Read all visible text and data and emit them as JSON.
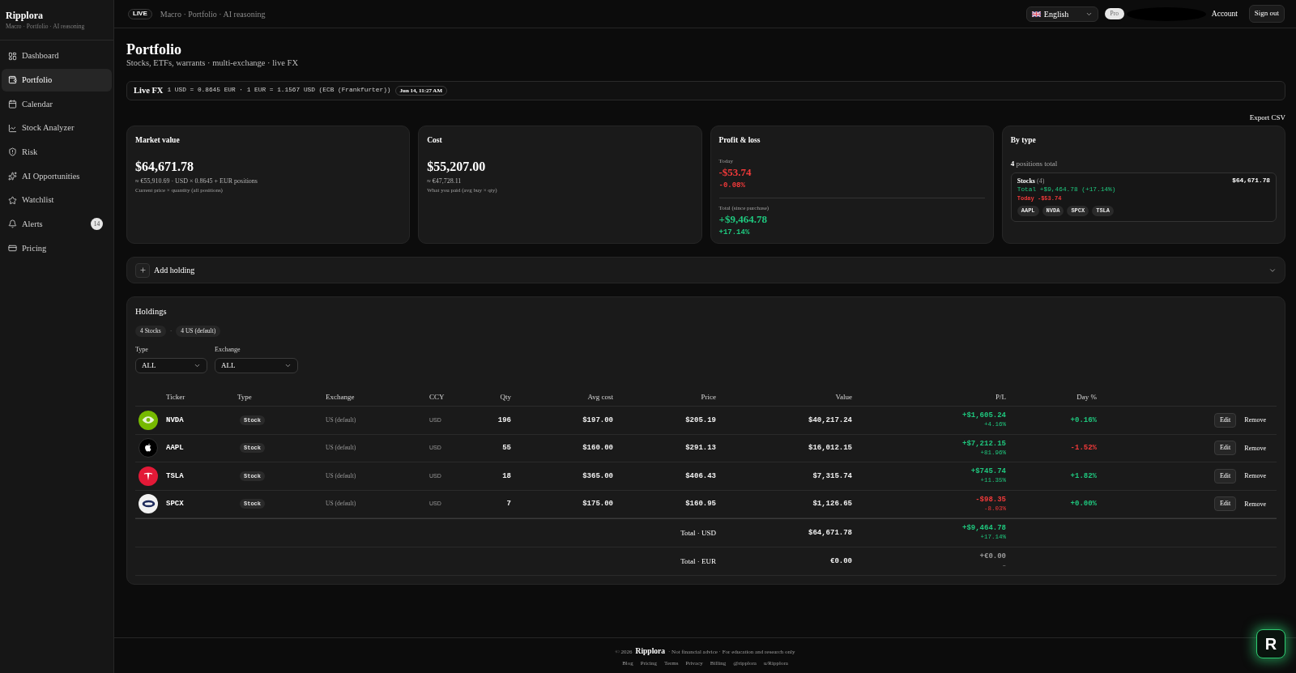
{
  "sidebar": {
    "brand": "Ripplora",
    "tagline": "Macro · Portfolio · AI reasoning",
    "items": [
      {
        "label": "Dashboard",
        "selected": false
      },
      {
        "label": "Portfolio",
        "selected": true
      },
      {
        "label": "Calendar",
        "selected": false
      },
      {
        "label": "Stock Analyzer",
        "selected": false
      },
      {
        "label": "Risk",
        "selected": false
      },
      {
        "label": "AI Opportunities",
        "selected": false
      },
      {
        "label": "Watchlist",
        "selected": false
      },
      {
        "label": "Alerts",
        "selected": false,
        "badge": "14"
      },
      {
        "label": "Pricing",
        "selected": false
      }
    ]
  },
  "top_bar": {
    "live_badge": "LIVE",
    "breadcrumb": "Macro · Portfolio · AI reasoning",
    "language": "English",
    "plan_badge": "Pro",
    "account_link": "Account",
    "sign_out": "Sign out"
  },
  "page": {
    "title": "Portfolio",
    "subtitle": "Stocks, ETFs, warrants · multi-exchange · live FX"
  },
  "fx_bar": {
    "label": "Live FX",
    "rates": "1 USD = 0.8645 EUR · 1 EUR = 1.1567 USD (ECB (Frankfurter))",
    "timestamp": "Jun 14, 11:27 AM"
  },
  "export_button": "Export CSV",
  "summary_cards": [
    {
      "title": "Market value",
      "value": "$64,671.78",
      "note": "≈ €55,910.69 · USD × 0.8645 + EUR positions",
      "caption": "Current price × quantity (all positions)"
    },
    {
      "title": "Cost",
      "value": "$55,207.00",
      "note": "≈ €47,728.11",
      "caption": "What you paid (avg buy × qty)"
    }
  ],
  "profit_loss": {
    "title": "Profit & loss",
    "periods": [
      {
        "label": "Today",
        "value": "-$53.74",
        "percent": "-0.08%",
        "negative": true
      },
      {
        "label": "Total (since purchase)",
        "value": "+$9,464.78",
        "percent": "+17.14%",
        "negative": false
      }
    ]
  },
  "by_type": {
    "title": "By type",
    "summary": "**4** positions total",
    "groups": [
      {
        "name": "Stocks",
        "count": "(4)",
        "value": "$64,671.78",
        "lines": [
          {
            "text": "Total +$9,464.78 (+17.14%)",
            "negative": false
          },
          {
            "text": "Today -$53.74",
            "negative": true
          }
        ],
        "tickers": [
          "AAPL",
          "NVDA",
          "SPCX",
          "TSLA"
        ]
      }
    ]
  },
  "add_holding": {
    "label": "Add holding",
    "expanded": false
  },
  "holdings": {
    "title": "Holdings",
    "chips": [
      "4 Stocks",
      "4 US (default)"
    ],
    "chip_separator": "·",
    "filters": [
      {
        "label": "Type",
        "value": "ALL"
      },
      {
        "label": "Exchange",
        "value": "ALL"
      }
    ],
    "table": {
      "columns": [
        "Ticker",
        "Type",
        "Exchange",
        "CCY",
        "Qty",
        "Avg cost",
        "Price",
        "Value",
        "P/L",
        "Day %"
      ],
      "rows": [
        {
          "ticker": "NVDA",
          "type": "Stock",
          "exchange": "US (default)",
          "ccy": "USD",
          "qty": "196",
          "avg_cost": "$197.00",
          "price": "$205.19",
          "value": "$40,217.24",
          "pl": {
            "value": "+$1,605.24",
            "percent": "+4.16%",
            "negative": false
          },
          "day": {
            "value": "+0.16%",
            "negative": false
          },
          "actions": [
            "Edit",
            "Remove"
          ]
        },
        {
          "ticker": "AAPL",
          "type": "Stock",
          "exchange": "US (default)",
          "ccy": "USD",
          "qty": "55",
          "avg_cost": "$160.00",
          "price": "$291.13",
          "value": "$16,012.15",
          "pl": {
            "value": "+$7,212.15",
            "percent": "+81.96%",
            "negative": false
          },
          "day": {
            "value": "-1.52%",
            "negative": true
          },
          "actions": [
            "Edit",
            "Remove"
          ]
        },
        {
          "ticker": "TSLA",
          "type": "Stock",
          "exchange": "US (default)",
          "ccy": "USD",
          "qty": "18",
          "avg_cost": "$365.00",
          "price": "$406.43",
          "value": "$7,315.74",
          "pl": {
            "value": "+$745.74",
            "percent": "+11.35%",
            "negative": false
          },
          "day": {
            "value": "+1.82%",
            "negative": false
          },
          "actions": [
            "Edit",
            "Remove"
          ]
        },
        {
          "ticker": "SPCX",
          "type": "Stock",
          "exchange": "US (default)",
          "ccy": "USD",
          "qty": "7",
          "avg_cost": "$175.00",
          "price": "$160.95",
          "value": "$1,126.65",
          "pl": {
            "value": "-$98.35",
            "percent": "-8.03%",
            "negative": true
          },
          "day": {
            "value": "+0.00%",
            "negative": false
          },
          "actions": [
            "Edit",
            "Remove"
          ]
        }
      ],
      "totals": [
        {
          "label": "Total · USD",
          "value": "$64,671.78",
          "pl": {
            "value": "+$9,464.78",
            "percent": "+17.14%",
            "negative": false,
            "muted": false
          }
        },
        {
          "label": "Total · EUR",
          "value": "€0.00",
          "pl": {
            "value": "+€0.00",
            "percent": "–",
            "muted": true
          }
        }
      ]
    }
  },
  "footer": {
    "copyright": "© 2026",
    "brand": "Ripplora",
    "disclaimer": "· Not financial advice · For education and research only",
    "links": [
      "Blog",
      "Pricing",
      "Terms",
      "Privacy",
      "Billing",
      "@ripplora",
      "u/Ripplora"
    ]
  },
  "launcher": {
    "label": "R"
  }
}
